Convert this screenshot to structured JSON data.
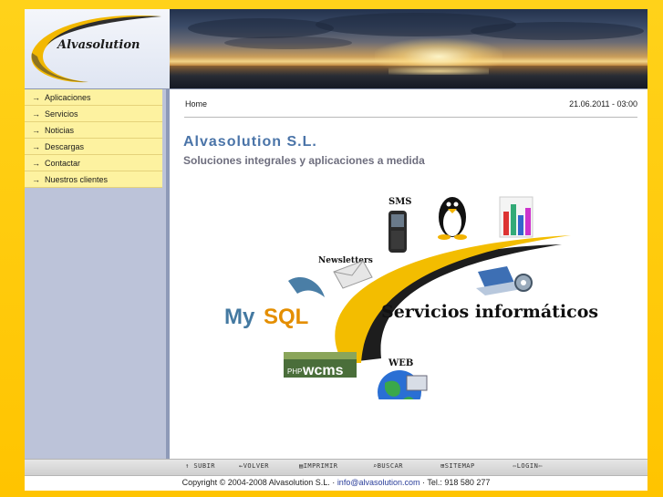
{
  "header": {
    "logo_text": "Alvasolution"
  },
  "sidebar": {
    "items": [
      {
        "label": "Aplicaciones"
      },
      {
        "label": "Servicios"
      },
      {
        "label": "Noticias"
      },
      {
        "label": "Descargas"
      },
      {
        "label": "Contactar"
      },
      {
        "label": "Nuestros clientes"
      }
    ],
    "arrow": "→"
  },
  "content": {
    "breadcrumb": "Home",
    "date": "21.06.2011 - 03:00",
    "title": "Alvasolution S.L.",
    "subtitle": "Soluciones integrales y aplicaciones a medida"
  },
  "graphic": {
    "sms_label": "SMS",
    "newsletters_label": "Newsletters",
    "mysql_my": "My",
    "mysql_sql": "SQL",
    "services_label": "Servicios informáticos",
    "php_label": "PHP",
    "wcms_label": "wcms",
    "web_label": "WEB"
  },
  "footer": {
    "subir": "↑ SUBIR",
    "volver": "←VOLVER",
    "imprimir": "IMPRIMIR",
    "buscar": "BUSCAR",
    "sitemap": "SITEMAP",
    "login": "LOGIN"
  },
  "copyright": {
    "text_before": "Copyright © 2004-2008 Alvasolution S.L.  · ",
    "email": "info@alvasolution.com",
    "text_after": " ·  Tel.: 918 580 277"
  },
  "colors": {
    "background": "#ffc400",
    "menu_bg": "#fdf2a0",
    "sidebar_bg": "#bcc3d9",
    "title": "#4a74a8",
    "link": "#2a3e9a"
  }
}
